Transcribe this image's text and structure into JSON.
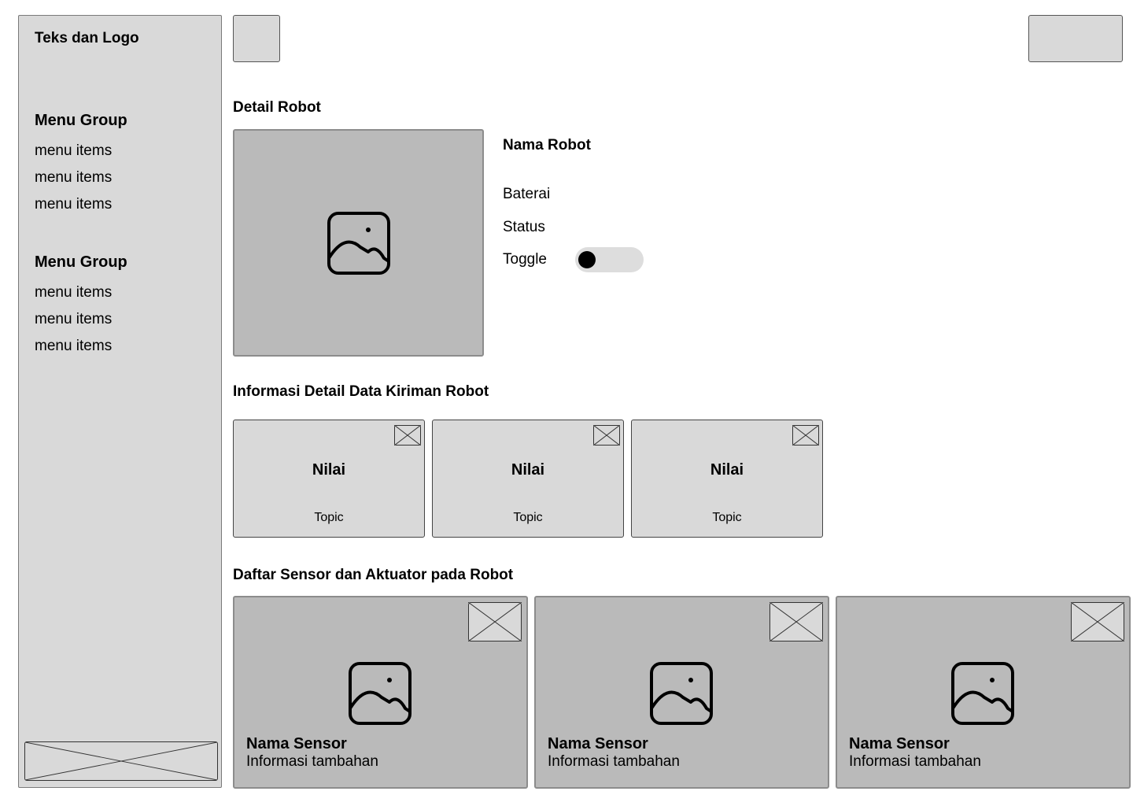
{
  "sidebar": {
    "brand": "Teks dan Logo",
    "groups": [
      {
        "title": "Menu Group",
        "items": [
          "menu items",
          "menu items",
          "menu items"
        ]
      },
      {
        "title": "Menu Group",
        "items": [
          "menu items",
          "menu items",
          "menu items"
        ]
      }
    ]
  },
  "detail": {
    "section_title": "Detail Robot",
    "robot_name": "Nama Robot",
    "battery_label": "Baterai",
    "status_label": "Status",
    "toggle_label": "Toggle",
    "toggle_state": "off"
  },
  "data_section": {
    "title": "Informasi Detail Data Kiriman Robot",
    "cards": [
      {
        "value": "Nilai",
        "topic": "Topic"
      },
      {
        "value": "Nilai",
        "topic": "Topic"
      },
      {
        "value": "Nilai",
        "topic": "Topic"
      }
    ]
  },
  "sensor_section": {
    "title": "Daftar Sensor dan Aktuator pada Robot",
    "cards": [
      {
        "name": "Nama Sensor",
        "info": "Informasi tambahan"
      },
      {
        "name": "Nama Sensor",
        "info": "Informasi tambahan"
      },
      {
        "name": "Nama Sensor",
        "info": "Informasi tambahan"
      }
    ]
  }
}
